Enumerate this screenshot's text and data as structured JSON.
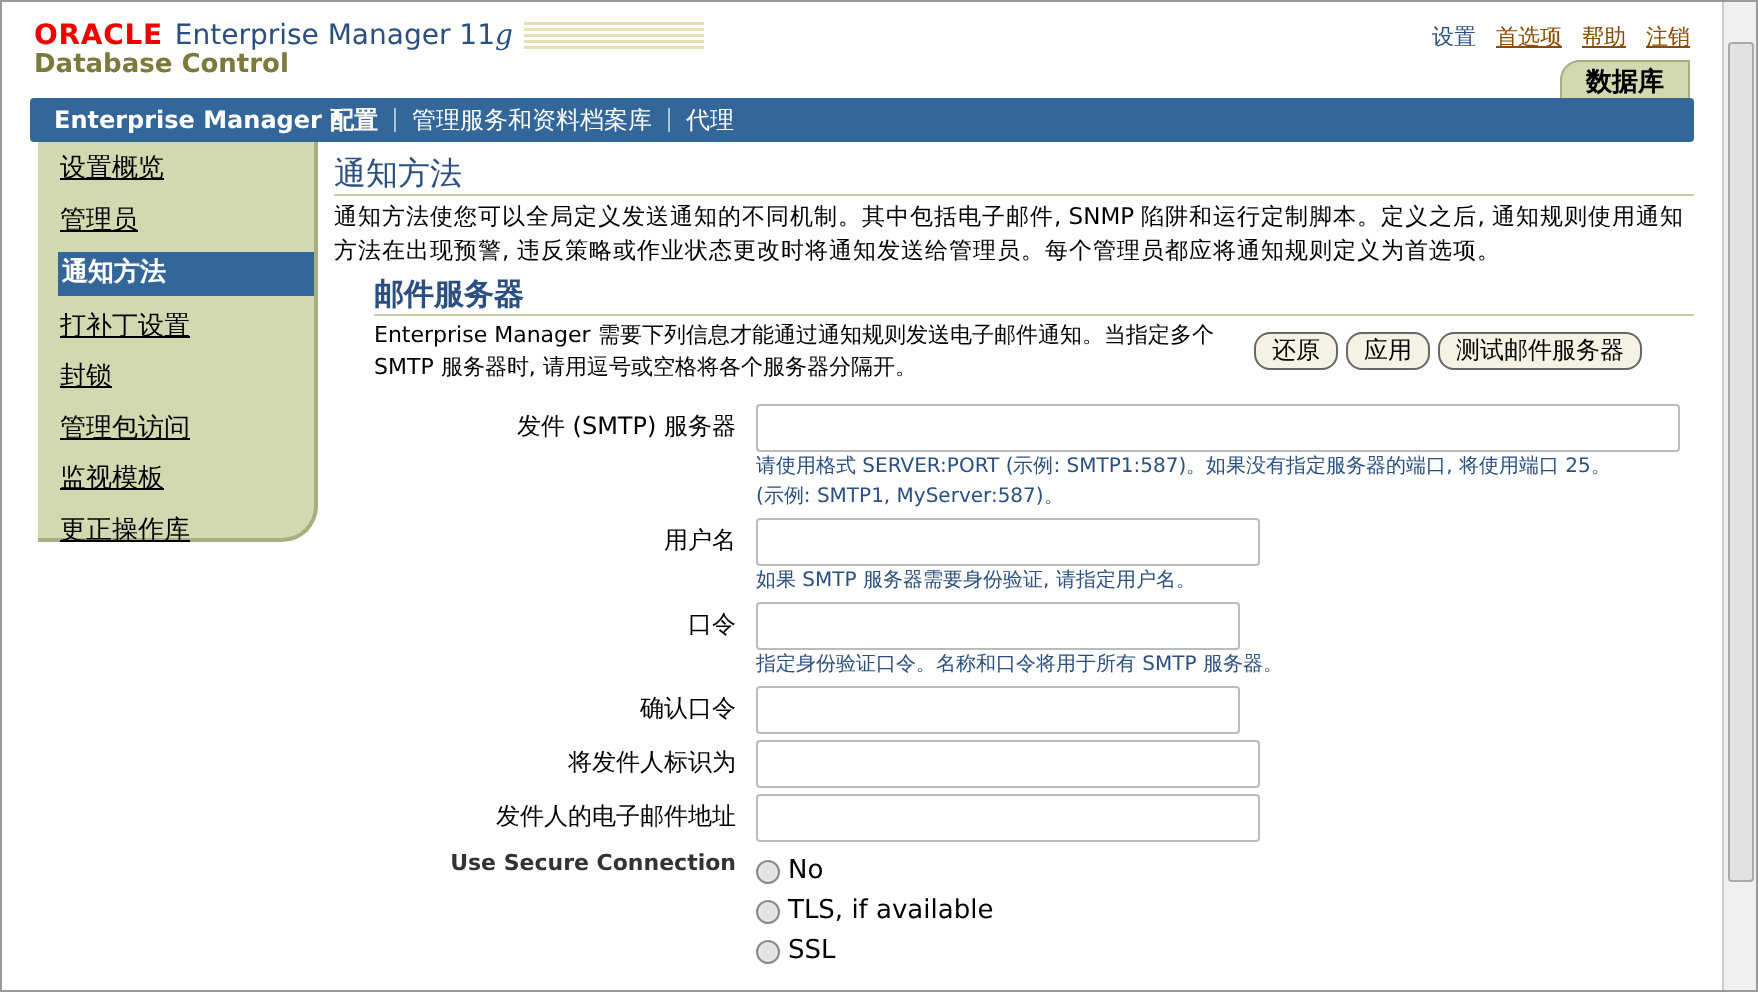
{
  "header": {
    "brand": "ORACLE",
    "product": "Enterprise Manager 11",
    "product_version": "g",
    "subtitle": "Database Control",
    "global_links": [
      {
        "label": "设置",
        "selected": true
      },
      {
        "label": "首选项",
        "selected": false
      },
      {
        "label": "帮助",
        "selected": false
      },
      {
        "label": "注销",
        "selected": false
      }
    ],
    "tab": "数据库"
  },
  "nav": [
    {
      "label": "Enterprise Manager 配置",
      "selected": true
    },
    {
      "label": "管理服务和资料档案库",
      "selected": false
    },
    {
      "label": "代理",
      "selected": false
    }
  ],
  "sidebar": {
    "items": [
      {
        "label": "设置概览",
        "selected": false
      },
      {
        "label": "管理员",
        "selected": false
      },
      {
        "label": "通知方法",
        "selected": true
      },
      {
        "label": "打补丁设置",
        "selected": false
      },
      {
        "label": "封锁",
        "selected": false
      },
      {
        "label": "管理包访问",
        "selected": false
      },
      {
        "label": "监视模板",
        "selected": false
      },
      {
        "label": "更正操作库",
        "selected": false
      }
    ]
  },
  "page": {
    "title": "通知方法",
    "description": "通知方法使您可以全局定义发送通知的不同机制。其中包括电子邮件, SNMP 陷阱和运行定制脚本。定义之后, 通知规则使用通知方法在出现预警, 违反策略或作业状态更改时将通知发送给管理员。每个管理员都应将通知规则定义为首选项。"
  },
  "mail_server": {
    "title": "邮件服务器",
    "description": "Enterprise Manager 需要下列信息才能通过通知规则发送电子邮件通知。当指定多个  SMTP 服务器时, 请用逗号或空格将各个服务器分隔开。",
    "buttons": [
      "还原",
      "应用",
      "测试邮件服务器"
    ],
    "fields": [
      {
        "label": "发件 (SMTP) 服务器",
        "hint": "请使用格式 SERVER:PORT (示例: SMTP1:587)。如果没有指定服务器的端口, 将使用端口 25。(示例: SMTP1, MyServer:587)。"
      },
      {
        "label": "用户名",
        "hint": "如果 SMTP 服务器需要身份验证, 请指定用户名。"
      },
      {
        "label": "口令",
        "hint": "指定身份验证口令。名称和口令将用于所有 SMTP 服务器。"
      },
      {
        "label": "确认口令"
      },
      {
        "label": "将发件人标识为"
      },
      {
        "label": "发件人的电子邮件地址"
      }
    ],
    "secure_connection": {
      "label": "Use Secure Connection",
      "options": [
        {
          "label": "No",
          "selected": false
        },
        {
          "label": "TLS, if available",
          "selected": false
        },
        {
          "label": "SSL",
          "selected": false
        }
      ]
    }
  }
}
